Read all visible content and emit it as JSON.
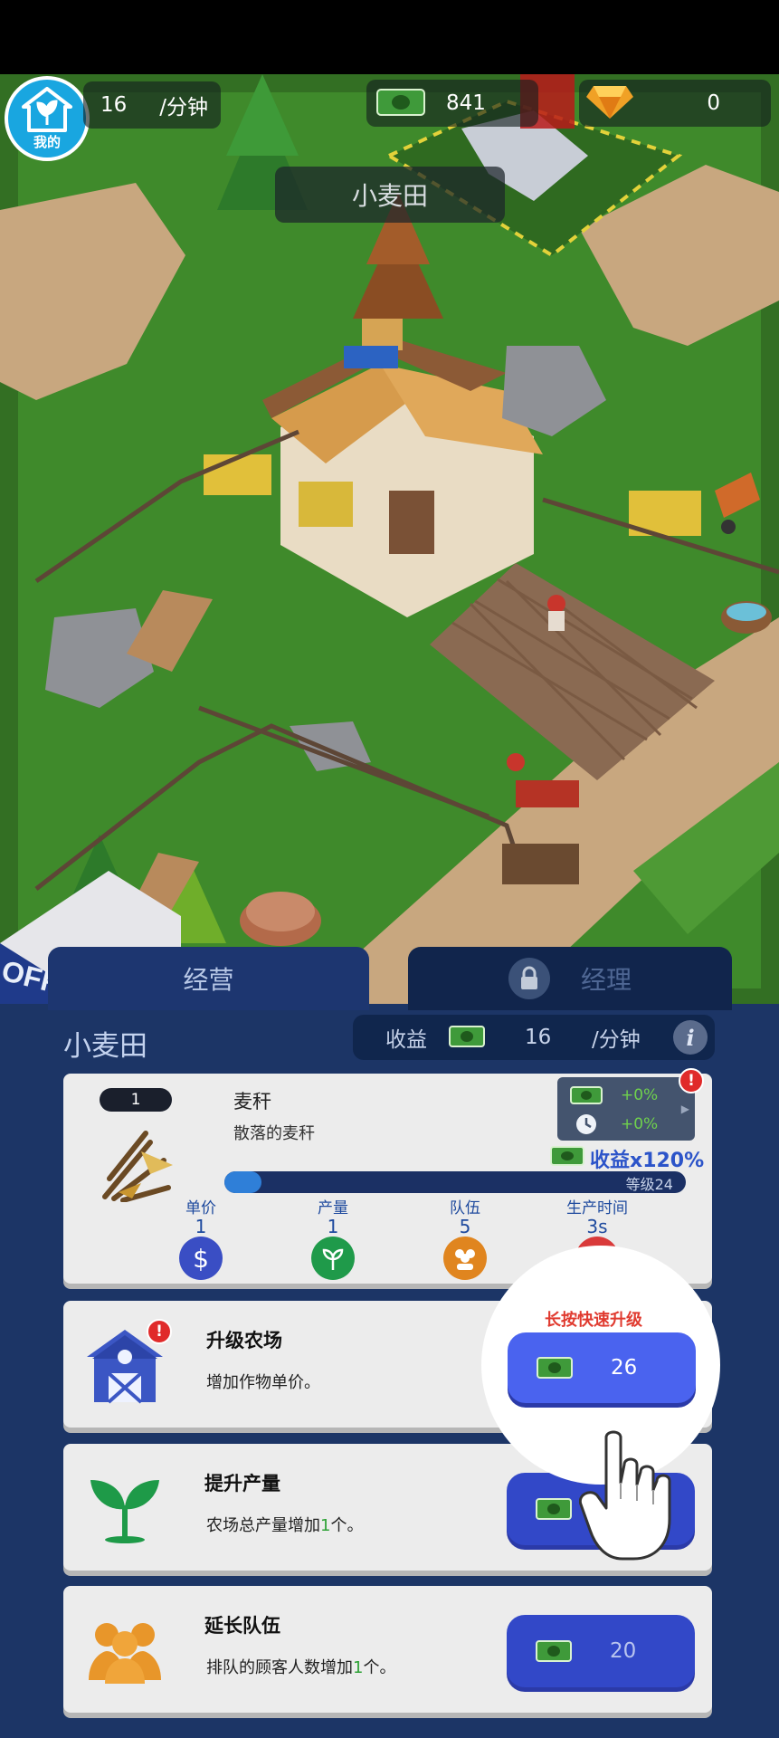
{
  "hud": {
    "home_label": "我的",
    "rate_value": "16",
    "rate_unit": "/分钟",
    "cash": "841",
    "gems": "0"
  },
  "scene": {
    "field_name": "小麦田",
    "office_sign": "OFFICE"
  },
  "tabs": {
    "operations": "经营",
    "manager": "经理"
  },
  "panel": {
    "title": "小麦田",
    "income_label": "收益",
    "income_value": "16",
    "income_unit": "/分钟",
    "info_glyph": "i"
  },
  "crop": {
    "level": "1",
    "name": "麦秆",
    "description": "散落的麦秆",
    "bonus_cash": "+0%",
    "bonus_time": "+0%",
    "multiplier": "收益x120%",
    "progress_label": "等级24",
    "progress_fraction": 0.08,
    "stats": [
      {
        "label": "单价",
        "value": "1",
        "color": "#3a4ec4"
      },
      {
        "label": "产量",
        "value": "1",
        "color": "#1f9a4a"
      },
      {
        "label": "队伍",
        "value": "5",
        "color": "#e0851f"
      },
      {
        "label": "生产时间",
        "value": "3s",
        "color": "#d93a3a"
      }
    ]
  },
  "upgrades": [
    {
      "title": "升级农场",
      "desc_before": "增加作物单价。",
      "desc_num": "",
      "desc_after": "",
      "price": "26",
      "icon": "barn-icon"
    },
    {
      "title": "提升产量",
      "desc_before": "农场总产量增加",
      "desc_num": "1",
      "desc_after": "个。",
      "price": "",
      "icon": "sprout-icon"
    },
    {
      "title": "延长队伍",
      "desc_before": "排队的顾客人数增加",
      "desc_num": "1",
      "desc_after": "个。",
      "price": "20",
      "icon": "people-icon"
    }
  ],
  "highlight": {
    "hint": "长按快速升级",
    "price": "26"
  },
  "warn_glyph": "!",
  "colors": {
    "accent_blue": "#4357e3",
    "panel_bg": "#1c3566",
    "grass": "#3f8a2b",
    "warn_red": "#e02a2a"
  }
}
